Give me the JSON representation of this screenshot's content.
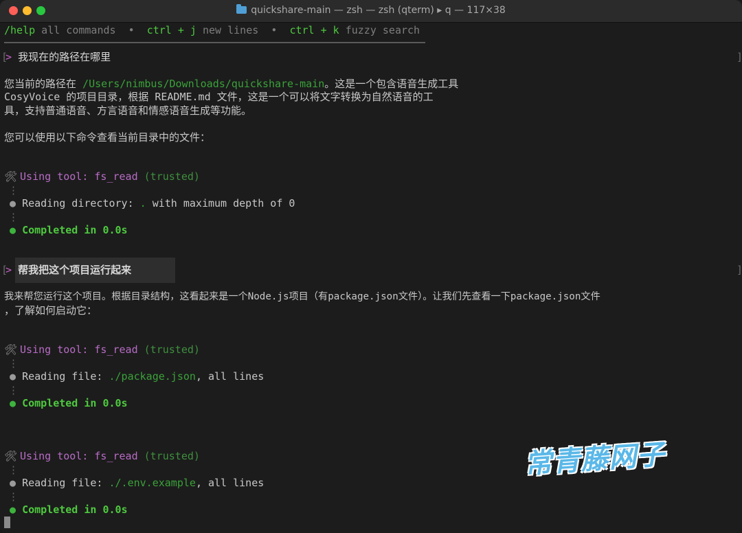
{
  "window": {
    "title": "quickshare-main — zsh — zsh (qterm) ▸ q — 117×38"
  },
  "help_bar": {
    "help_cmd": "/help",
    "help_text": " all commands",
    "sep": "  •  ",
    "ctrl_j": "ctrl + j",
    "ctrl_j_text": " new lines",
    "ctrl_k": "ctrl + k",
    "ctrl_k_text": " fuzzy search"
  },
  "conversation": {
    "q1_marker": ">",
    "q1_text": "我现在的路径在哪里",
    "a1_line1_pre": "您当前的路径在 ",
    "a1_path": "/Users/nimbus/Downloads/quickshare-main",
    "a1_line1_post": "。这是一个包含语音生成工具",
    "a1_line2": "CosyVoice 的项目目录，根据 README.md 文件，这是一个可以将文字转换为自然语音的工",
    "a1_line3": "具，支持普通语音、方言语音和情感语音生成等功能。",
    "a1_line4": "您可以使用以下命令查看当前目录中的文件：",
    "tool1_using": "Using tool: fs_read",
    "tool1_trusted": " (trusted)",
    "tool1_vdots_a": "⋮",
    "tool1_read_label": "Reading directory: ",
    "tool1_read_target": ".",
    "tool1_read_rest": " with maximum depth of 0",
    "tool1_vdots_b": "⋮",
    "tool1_done": "Completed in 0.0s",
    "q2_marker": ">",
    "q2_text": "帮我把这个项目运行起来",
    "a2_line1": "我来帮您运行这个项目。根据目录结构，这看起来是一个Node.js项目（有package.json文件）。让我们先查看一下package.json文件",
    "a2_line2": "，了解如何启动它：",
    "tool2_using": "Using tool: fs_read",
    "tool2_trusted": " (trusted)",
    "tool2_vdots_a": "⋮",
    "tool2_read_label": "Reading file: ",
    "tool2_read_target": "./package.json",
    "tool2_read_rest": ", all lines",
    "tool2_vdots_b": "⋮",
    "tool2_done": "Completed in 0.0s",
    "tool3_using": "Using tool: fs_read",
    "tool3_trusted": " (trusted)",
    "tool3_vdots_a": "⋮",
    "tool3_read_label": "Reading file: ",
    "tool3_read_target": "./.env.example",
    "tool3_read_rest": ", all lines",
    "tool3_vdots_b": "⋮",
    "tool3_done": "Completed in 0.0s"
  },
  "symbols": {
    "tool_icon": "🛠",
    "bullet": "●",
    "bracket_left": "[",
    "bracket_right": "]"
  },
  "watermark": "常青藤网子",
  "colors": {
    "green": "#4ec93f",
    "purple": "#b86cc6",
    "path_green": "#3aa23a",
    "background": "#1c1c1c"
  }
}
